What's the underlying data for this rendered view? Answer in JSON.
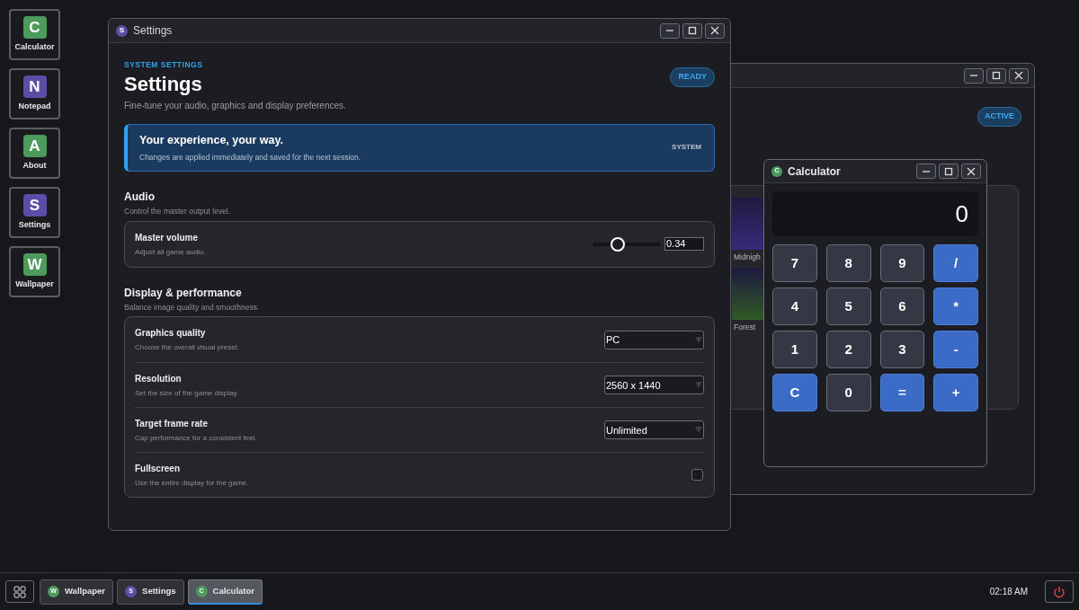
{
  "desktop_icons": [
    {
      "letter": "C",
      "label": "Calculator",
      "color": "#4c9a5c"
    },
    {
      "letter": "N",
      "label": "Notepad",
      "color": "#5a4ea6"
    },
    {
      "letter": "A",
      "label": "About",
      "color": "#4c9a5c"
    },
    {
      "letter": "S",
      "label": "Settings",
      "color": "#5a4ea6"
    },
    {
      "letter": "W",
      "label": "Wallpaper",
      "color": "#4c9a5c"
    }
  ],
  "wallpaper_window": {
    "badge": "ACTIVE",
    "thumbnails": [
      {
        "label": "Midnigh",
        "color": "#3a2a7a"
      },
      {
        "label": "Forest",
        "color": "#2f5a25"
      }
    ]
  },
  "settings_window": {
    "title": "Settings",
    "icon_letter": "S",
    "eyebrow": "SYSTEM SETTINGS",
    "heading": "Settings",
    "subtitle": "Fine-tune your audio, graphics and display preferences.",
    "badge": "READY",
    "banner": {
      "title": "Your experience, your way.",
      "text": "Changes are applied immediately and saved for the next session.",
      "tag": "SYSTEM"
    },
    "sections": [
      {
        "title": "Audio",
        "subtitle": "Control the master output level.",
        "rows": [
          {
            "kind": "slider",
            "label": "Master volume",
            "description": "Adjust all game audio.",
            "level": 0.34,
            "reading": "0.34"
          }
        ]
      },
      {
        "title": "Display & performance",
        "subtitle": "Balance image quality and smoothness.",
        "rows": [
          {
            "kind": "select",
            "label": "Graphics quality",
            "description": "Choose the overall visual preset.",
            "value": "PC"
          },
          {
            "kind": "select",
            "label": "Resolution",
            "description": "Set the size of the game display.",
            "value": "2560 x 1440"
          },
          {
            "kind": "select",
            "label": "Target frame rate",
            "description": "Cap performance for a consistent feel.",
            "value": "Unlimited"
          },
          {
            "kind": "checkbox",
            "label": "Fullscreen",
            "description": "Use the entire display for the game.",
            "checked": false
          }
        ]
      }
    ]
  },
  "calculator_window": {
    "title": "Calculator",
    "icon_letter": "C",
    "display": "0",
    "keys": [
      {
        "label": "7",
        "kind": "digit"
      },
      {
        "label": "8",
        "kind": "digit"
      },
      {
        "label": "9",
        "kind": "digit"
      },
      {
        "label": "/",
        "kind": "operator"
      },
      {
        "label": "4",
        "kind": "digit"
      },
      {
        "label": "5",
        "kind": "digit"
      },
      {
        "label": "6",
        "kind": "digit"
      },
      {
        "label": "*",
        "kind": "operator"
      },
      {
        "label": "1",
        "kind": "digit"
      },
      {
        "label": "2",
        "kind": "digit"
      },
      {
        "label": "3",
        "kind": "digit"
      },
      {
        "label": "-",
        "kind": "operator"
      },
      {
        "label": "C",
        "kind": "clear"
      },
      {
        "label": "0",
        "kind": "digit"
      },
      {
        "label": "=",
        "kind": "equals"
      },
      {
        "label": "+",
        "kind": "operator"
      }
    ]
  },
  "taskbar": {
    "tasks": [
      {
        "letter": "W",
        "label": "Wallpaper",
        "color": "#4c9a5c",
        "selected": false
      },
      {
        "letter": "S",
        "label": "Settings",
        "color": "#5a4ea6",
        "selected": false
      },
      {
        "letter": "C",
        "label": "Calculator",
        "color": "#4c9a5c",
        "selected": true
      }
    ],
    "clock": "02:18 AM"
  }
}
